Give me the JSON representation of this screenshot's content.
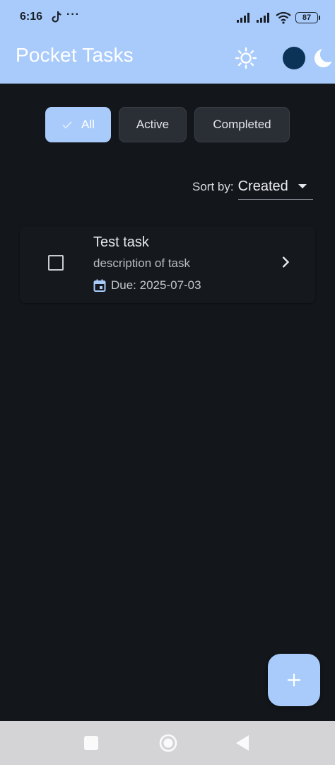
{
  "status_bar": {
    "time": "6:16",
    "dots": "···",
    "battery": "87"
  },
  "app_bar": {
    "title": "Pocket Tasks"
  },
  "filters": {
    "items": [
      {
        "label": "All",
        "selected": true
      },
      {
        "label": "Active",
        "selected": false
      },
      {
        "label": "Completed",
        "selected": false
      }
    ]
  },
  "sort": {
    "label": "Sort by:",
    "value": "Created"
  },
  "tasks": [
    {
      "title": "Test task",
      "description": "description of task",
      "due": "Due: 2025-07-03",
      "completed": false
    }
  ],
  "icons": {
    "theme_light": "sun-icon",
    "theme_dark": "moon-icon",
    "add": "plus-icon",
    "calendar": "calendar-icon",
    "open": "chevron-right-icon"
  },
  "colors": {
    "accent": "#a8cbfb",
    "background": "#13161b",
    "dark_circle": "#0b3357"
  }
}
